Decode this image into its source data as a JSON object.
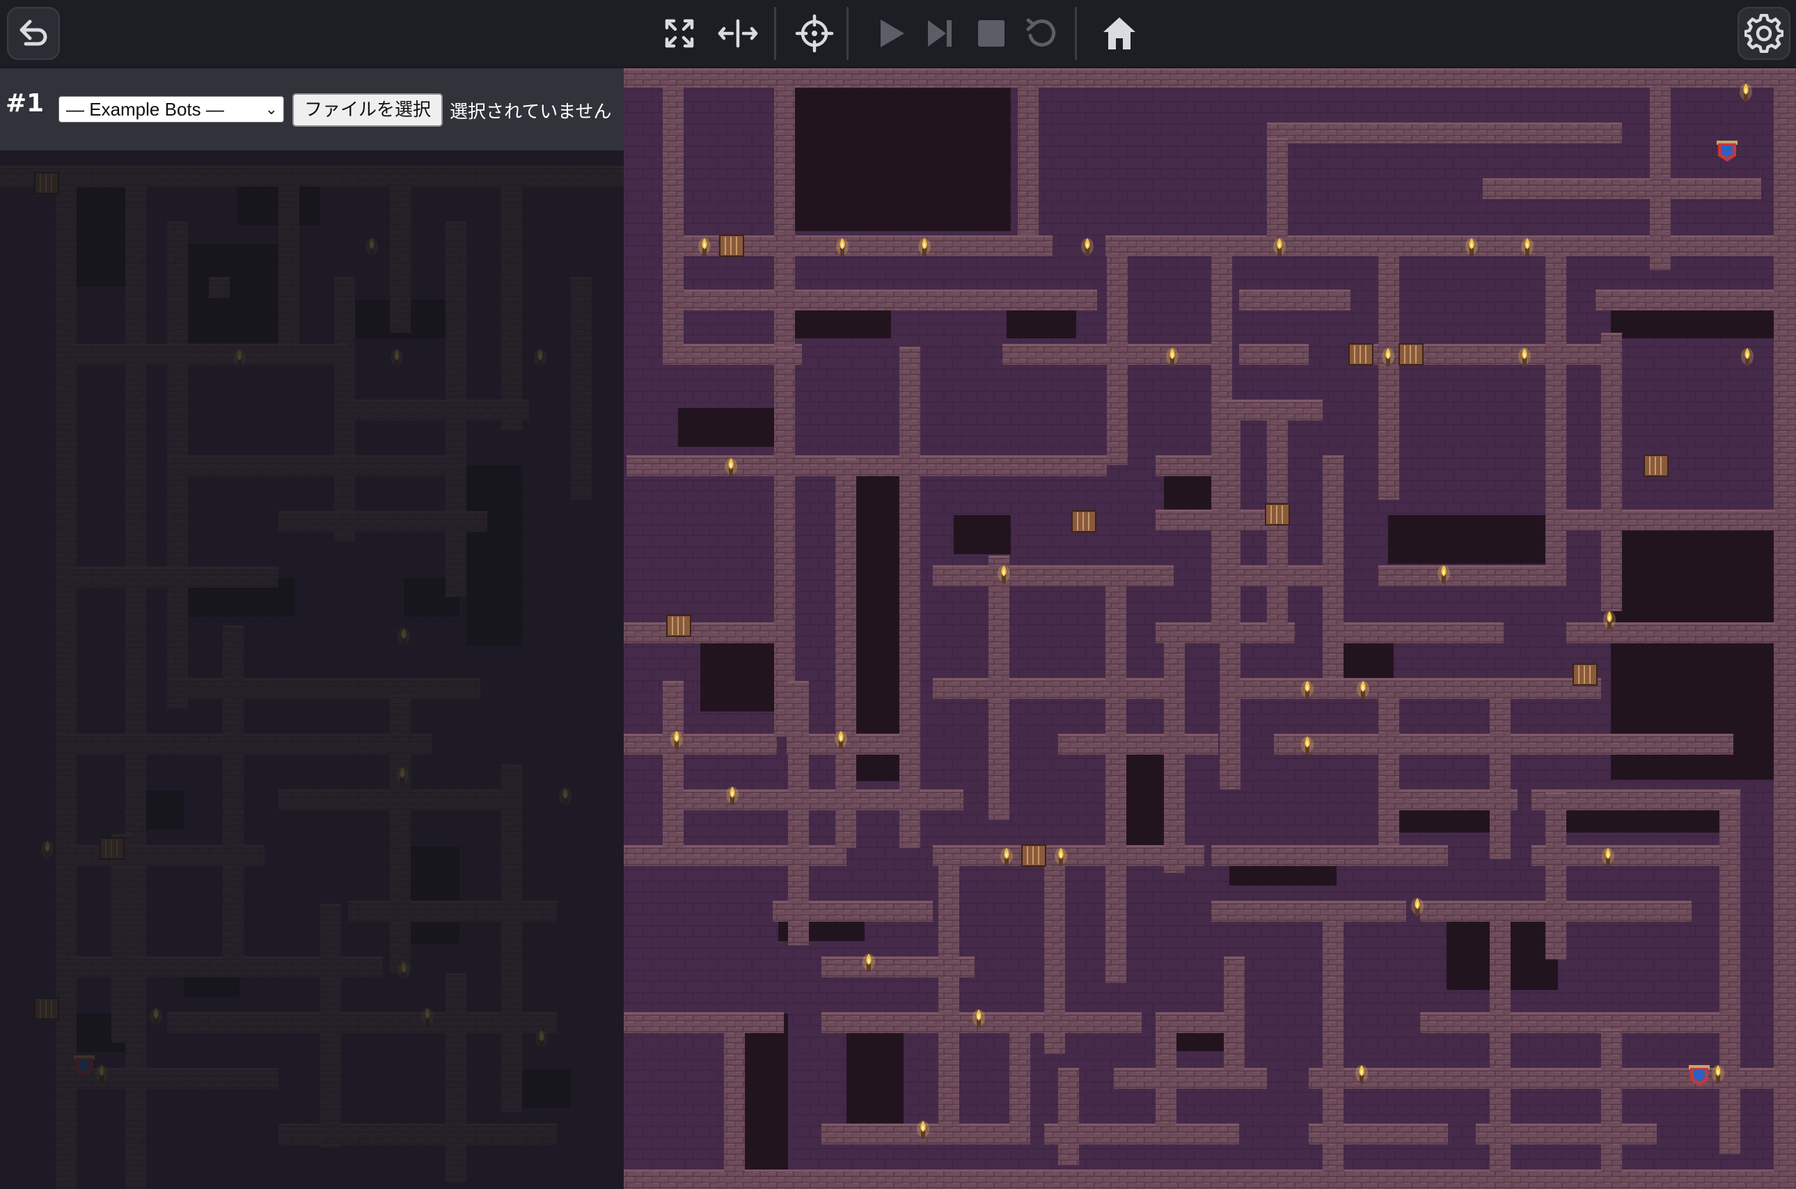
{
  "toolbar": {
    "back_icon": "undo-arrow-icon",
    "fullscreen_icon": "expand-arrows-icon",
    "split_icon": "horizontal-resize-icon",
    "center_icon": "crosshair-target-icon",
    "play_icon": "play-icon",
    "step_icon": "skip-forward-icon",
    "stop_icon": "stop-icon",
    "restart_icon": "rotate-left-icon",
    "home_icon": "home-icon",
    "settings_icon": "gear-icon"
  },
  "bot_panel": {
    "bot_number": "#1",
    "select_value": "— Example Bots —",
    "file_button_label": "ファイルを選択",
    "file_status": "選択されていません"
  },
  "colors": {
    "floor": "#452a4a",
    "wall": "#6e4c5b",
    "wall_light": "#86606c",
    "pit": "#22141f",
    "torch_flame": "#f3c54a",
    "flag_red": "#c23a3a",
    "flag_blue": "#2f5fc0",
    "toolbar_bg": "#1c1e23",
    "icon_active": "#d9dbe0",
    "icon_disabled": "#5b5e66"
  },
  "game": {
    "visible_region": "right",
    "fogged_region": "left",
    "flags_visible": 3
  }
}
